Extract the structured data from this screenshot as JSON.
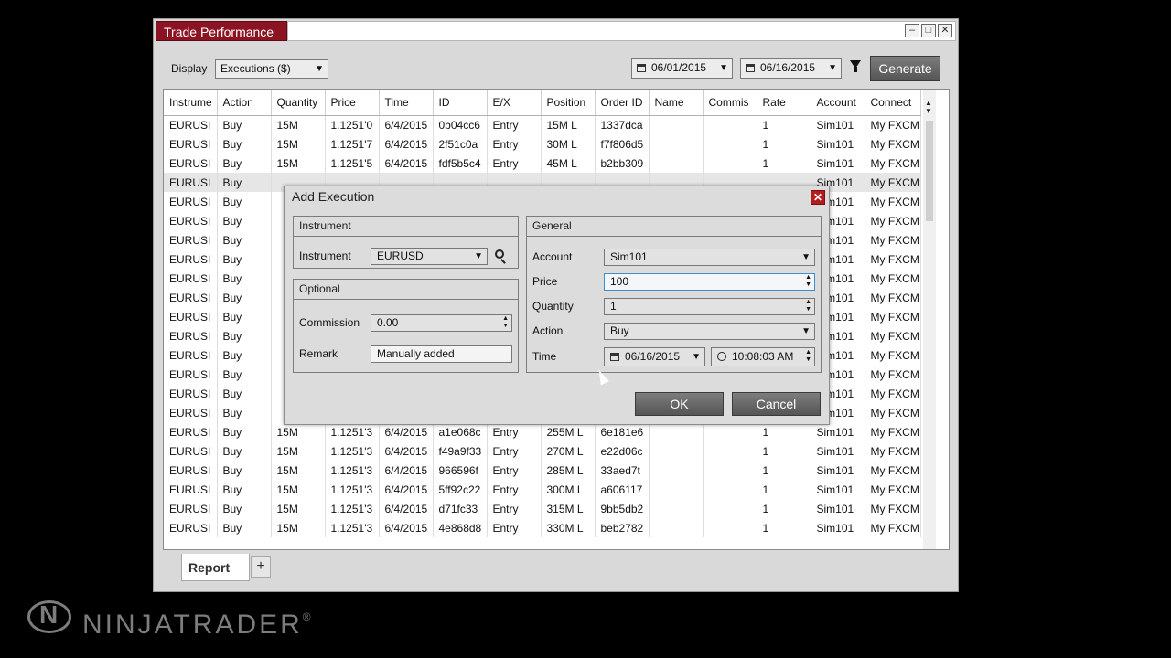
{
  "window": {
    "title": "Trade Performance",
    "minimize": "–",
    "maximize": "□",
    "close": "✕"
  },
  "toolbar": {
    "display_label": "Display",
    "display_value": "Executions ($)",
    "from_date": "06/01/2015",
    "to_date": "06/16/2015",
    "generate_label": "Generate"
  },
  "grid": {
    "columns": [
      "Instrume",
      "Action",
      "Quantity",
      "Price",
      "Time",
      "ID",
      "E/X",
      "Position",
      "Order ID",
      "Name",
      "Commis",
      "Rate",
      "Account",
      "Connect"
    ],
    "rows": [
      [
        "EURUSI",
        "Buy",
        "15M",
        "1.1251'0",
        "6/4/2015",
        "0b04cc6",
        "Entry",
        "15M  L",
        "1337dca",
        "",
        "",
        "1",
        "Sim101",
        "My FXCM"
      ],
      [
        "EURUSI",
        "Buy",
        "15M",
        "1.1251'7",
        "6/4/2015",
        "2f51c0a",
        "Entry",
        "30M  L",
        "f7f806d5",
        "",
        "",
        "1",
        "Sim101",
        "My FXCM"
      ],
      [
        "EURUSI",
        "Buy",
        "15M",
        "1.1251'5",
        "6/4/2015",
        "fdf5b5c4",
        "Entry",
        "45M  L",
        "b2bb309",
        "",
        "",
        "1",
        "Sim101",
        "My FXCM"
      ],
      [
        "EURUSI",
        "Buy",
        "",
        "",
        "",
        "",
        "",
        "",
        "",
        "",
        "",
        "",
        "Sim101",
        "My FXCM"
      ],
      [
        "EURUSI",
        "Buy",
        "",
        "",
        "",
        "",
        "",
        "",
        "",
        "",
        "",
        "",
        "Sim101",
        "My FXCM"
      ],
      [
        "EURUSI",
        "Buy",
        "",
        "",
        "",
        "",
        "",
        "",
        "",
        "",
        "",
        "",
        "Sim101",
        "My FXCM"
      ],
      [
        "EURUSI",
        "Buy",
        "",
        "",
        "",
        "",
        "",
        "",
        "",
        "",
        "",
        "",
        "Sim101",
        "My FXCM"
      ],
      [
        "EURUSI",
        "Buy",
        "",
        "",
        "",
        "",
        "",
        "",
        "",
        "",
        "",
        "",
        "Sim101",
        "My FXCM"
      ],
      [
        "EURUSI",
        "Buy",
        "",
        "",
        "",
        "",
        "",
        "",
        "",
        "",
        "",
        "",
        "Sim101",
        "My FXCM"
      ],
      [
        "EURUSI",
        "Buy",
        "",
        "",
        "",
        "",
        "",
        "",
        "",
        "",
        "",
        "",
        "Sim101",
        "My FXCM"
      ],
      [
        "EURUSI",
        "Buy",
        "",
        "",
        "",
        "",
        "",
        "",
        "",
        "",
        "",
        "",
        "Sim101",
        "My FXCM"
      ],
      [
        "EURUSI",
        "Buy",
        "",
        "",
        "",
        "",
        "",
        "",
        "",
        "",
        "",
        "",
        "Sim101",
        "My FXCM"
      ],
      [
        "EURUSI",
        "Buy",
        "",
        "",
        "",
        "",
        "",
        "",
        "",
        "",
        "",
        "",
        "Sim101",
        "My FXCM"
      ],
      [
        "EURUSI",
        "Buy",
        "",
        "",
        "",
        "",
        "",
        "",
        "",
        "",
        "",
        "",
        "Sim101",
        "My FXCM"
      ],
      [
        "EURUSI",
        "Buy",
        "",
        "",
        "",
        "",
        "",
        "",
        "",
        "",
        "",
        "",
        "Sim101",
        "My FXCM"
      ],
      [
        "EURUSI",
        "Buy",
        "",
        "",
        "",
        "",
        "",
        "",
        "",
        "",
        "",
        "",
        "Sim101",
        "My FXCM"
      ],
      [
        "EURUSI",
        "Buy",
        "15M",
        "1.1251'3",
        "6/4/2015",
        "a1e068c",
        "Entry",
        "255M  L",
        "6e181e6",
        "",
        "",
        "1",
        "Sim101",
        "My FXCM"
      ],
      [
        "EURUSI",
        "Buy",
        "15M",
        "1.1251'3",
        "6/4/2015",
        "f49a9f33",
        "Entry",
        "270M  L",
        "e22d06c",
        "",
        "",
        "1",
        "Sim101",
        "My FXCM"
      ],
      [
        "EURUSI",
        "Buy",
        "15M",
        "1.1251'3",
        "6/4/2015",
        "966596f",
        "Entry",
        "285M  L",
        "33aed7t",
        "",
        "",
        "1",
        "Sim101",
        "My FXCM"
      ],
      [
        "EURUSI",
        "Buy",
        "15M",
        "1.1251'3",
        "6/4/2015",
        "5ff92c22",
        "Entry",
        "300M  L",
        "a606117",
        "",
        "",
        "1",
        "Sim101",
        "My FXCM"
      ],
      [
        "EURUSI",
        "Buy",
        "15M",
        "1.1251'3",
        "6/4/2015",
        "d71fc33",
        "Entry",
        "315M  L",
        "9bb5db2",
        "",
        "",
        "1",
        "Sim101",
        "My FXCM"
      ],
      [
        "EURUSI",
        "Buy",
        "15M",
        "1.1251'3",
        "6/4/2015",
        "4e868d8",
        "Entry",
        "330M  L",
        "beb2782",
        "",
        "",
        "1",
        "Sim101",
        "My FXCM"
      ]
    ]
  },
  "tabs": {
    "report_label": "Report",
    "add_label": "+"
  },
  "dialog": {
    "title": "Add Execution",
    "instrument_group": "Instrument",
    "instrument_label": "Instrument",
    "instrument_value": "EURUSD",
    "optional_group": "Optional",
    "commission_label": "Commission",
    "commission_value": "0.00",
    "remark_label": "Remark",
    "remark_value": "Manually added",
    "general_group": "General",
    "account_label": "Account",
    "account_value": "Sim101",
    "price_label": "Price",
    "price_value": "100",
    "quantity_label": "Quantity",
    "quantity_value": "1",
    "action_label": "Action",
    "action_value": "Buy",
    "time_label": "Time",
    "date_value": "06/16/2015",
    "time_value": "10:08:03 AM",
    "ok_label": "OK",
    "cancel_label": "Cancel"
  },
  "branding": {
    "logo_text": "NINJATRADER",
    "registered": "®"
  },
  "colors": {
    "title_tab": "#8c1322",
    "close_button": "#b71c1c",
    "focus_border": "#3b8fd0"
  }
}
